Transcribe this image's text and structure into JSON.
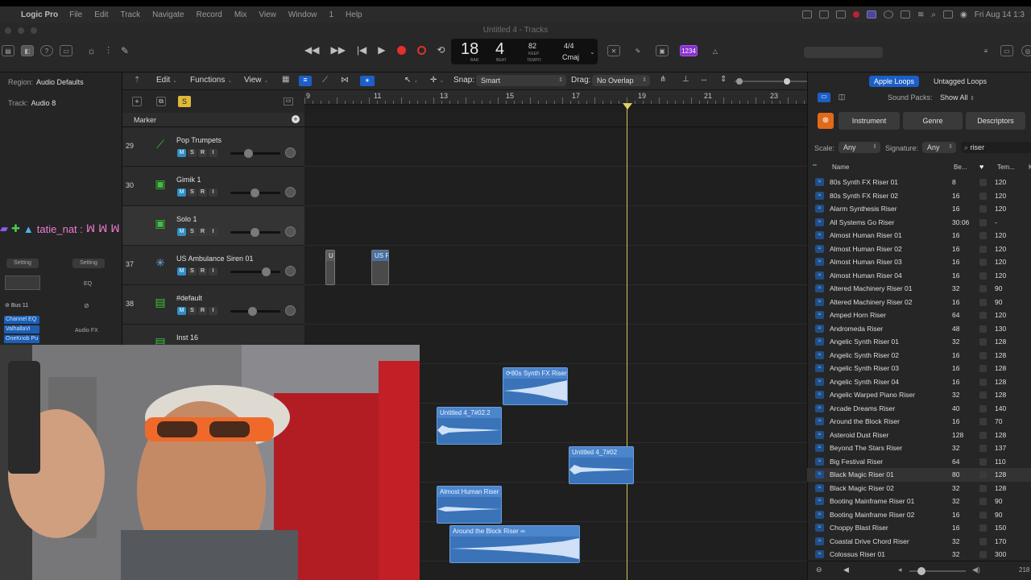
{
  "menubar": {
    "app": "Logic Pro",
    "items": [
      "File",
      "Edit",
      "Track",
      "Navigate",
      "Record",
      "Mix",
      "View",
      "Window",
      "1",
      "Help"
    ],
    "datetime": "Fri Aug 14 1:3"
  },
  "window": {
    "title": "Untitled 4 - Tracks"
  },
  "lcd": {
    "bar": "18",
    "beat": "4",
    "bar_label": "BAR",
    "beat_label": "BEAT",
    "tempo": "82",
    "tempo_mode": "KEEP",
    "tempo_label": "TEMPO",
    "time_signature": "4/4",
    "key": "Cmaj"
  },
  "count_in_badge": "1234",
  "inspector": {
    "region_label": "Region:",
    "region_value": "Audio Defaults",
    "track_label": "Track:",
    "track_value": "Audio 8",
    "setting_left": "Setting",
    "setting_right": "Setting",
    "eq": "EQ",
    "bus": "Bus 11",
    "plugins": [
      "Channel EQ",
      "ValhallaVi",
      "OneKnob Pu"
    ],
    "audio_fx": "Audio FX",
    "chat_user": "tatie_nat :"
  },
  "toolbar": {
    "edit": "Edit",
    "functions": "Functions",
    "view": "View",
    "snap_label": "Snap:",
    "snap_value": "Smart",
    "drag_label": "Drag:",
    "drag_value": "No Overlap"
  },
  "ruler": {
    "bars": [
      "9",
      "11",
      "13",
      "15",
      "17",
      "19",
      "21",
      "23"
    ]
  },
  "marker": {
    "label": "Marker"
  },
  "tracks": [
    {
      "num": "29",
      "name": "Pop Trumpets",
      "color": "#3fbf3f",
      "icon": "trumpet-icon",
      "glyph": "⟋",
      "fader": 0.3
    },
    {
      "num": "30",
      "name": "Gimik 1",
      "color": "#3fbf3f",
      "icon": "synth-icon",
      "glyph": "▣",
      "fader": 0.45
    },
    {
      "num": "",
      "name": "Solo 1",
      "color": "#3fbf3f",
      "icon": "synth-icon",
      "glyph": "▣",
      "fader": 0.45
    },
    {
      "num": "37",
      "name": "US Ambulance Siren 01",
      "color": "#6fa9e8",
      "icon": "star-icon",
      "glyph": "✳",
      "fader": 0.7
    },
    {
      "num": "38",
      "name": "#default",
      "color": "#3fbf3f",
      "icon": "keyboard-icon",
      "glyph": "▤",
      "fader": 0.4
    },
    {
      "num": "",
      "name": "Inst 16",
      "color": "#3fbf3f",
      "icon": "keyboard-icon",
      "glyph": "▤",
      "fader": 0.4
    }
  ],
  "track_buttons": {
    "m": "M",
    "s": "S",
    "r": "R",
    "i": "I"
  },
  "regions": [
    {
      "label": "U"
    },
    {
      "label": "US P"
    },
    {
      "label": "80s Synth FX Riser"
    },
    {
      "label": "Untitled 4_7#02.2"
    },
    {
      "label": "Untitled 4_7#02"
    },
    {
      "label": "Almost Human Riser"
    },
    {
      "label": "Around the Block Riser"
    }
  ],
  "browser": {
    "tab_apple": "Apple Loops",
    "tab_untagged": "Untagged Loops",
    "sound_packs_label": "Sound Packs:",
    "sound_packs_value": "Show All",
    "cat_instrument": "Instrument",
    "cat_genre": "Genre",
    "cat_descriptors": "Descriptors",
    "scale_label": "Scale:",
    "scale_value": "Any",
    "signature_label": "Signature:",
    "signature_value": "Any",
    "search_value": "riser",
    "col_name": "Name",
    "col_beats": "Be...",
    "col_tempo": "Tem...",
    "col_key": "K",
    "footer_count": "218",
    "loops": [
      {
        "name": "80s Synth FX Riser 01",
        "beats": "8",
        "tempo": "120"
      },
      {
        "name": "80s Synth FX Riser 02",
        "beats": "16",
        "tempo": "120"
      },
      {
        "name": "Alarm Synthesis Riser",
        "beats": "16",
        "tempo": "120"
      },
      {
        "name": "All Systems Go Riser",
        "beats": "30:06",
        "tempo": "-"
      },
      {
        "name": "Almost Human Riser 01",
        "beats": "16",
        "tempo": "120"
      },
      {
        "name": "Almost Human Riser 02",
        "beats": "16",
        "tempo": "120"
      },
      {
        "name": "Almost Human Riser 03",
        "beats": "16",
        "tempo": "120"
      },
      {
        "name": "Almost Human Riser 04",
        "beats": "16",
        "tempo": "120"
      },
      {
        "name": "Altered Machinery Riser 01",
        "beats": "32",
        "tempo": "90"
      },
      {
        "name": "Altered Machinery Riser 02",
        "beats": "16",
        "tempo": "90"
      },
      {
        "name": "Amped Horn Riser",
        "beats": "64",
        "tempo": "120"
      },
      {
        "name": "Andromeda Riser",
        "beats": "48",
        "tempo": "130"
      },
      {
        "name": "Angelic Synth Riser 01",
        "beats": "32",
        "tempo": "128"
      },
      {
        "name": "Angelic Synth Riser 02",
        "beats": "16",
        "tempo": "128"
      },
      {
        "name": "Angelic Synth Riser 03",
        "beats": "16",
        "tempo": "128"
      },
      {
        "name": "Angelic Synth Riser 04",
        "beats": "16",
        "tempo": "128"
      },
      {
        "name": "Angelic Warped Piano Riser",
        "beats": "32",
        "tempo": "128"
      },
      {
        "name": "Arcade Dreams Riser",
        "beats": "40",
        "tempo": "140"
      },
      {
        "name": "Around the Block Riser",
        "beats": "16",
        "tempo": "70"
      },
      {
        "name": "Asteroid Dust Riser",
        "beats": "128",
        "tempo": "128"
      },
      {
        "name": "Beyond The Stars Riser",
        "beats": "32",
        "tempo": "137"
      },
      {
        "name": "Big Festival Riser",
        "beats": "64",
        "tempo": "110"
      },
      {
        "name": "Black Magic Riser 01",
        "beats": "80",
        "tempo": "128"
      },
      {
        "name": "Black Magic Riser 02",
        "beats": "32",
        "tempo": "128"
      },
      {
        "name": "Booting Mainframe Riser 01",
        "beats": "32",
        "tempo": "90"
      },
      {
        "name": "Booting Mainframe Riser 02",
        "beats": "16",
        "tempo": "90"
      },
      {
        "name": "Choppy Blast Riser",
        "beats": "16",
        "tempo": "150"
      },
      {
        "name": "Coastal Drive Chord Riser",
        "beats": "32",
        "tempo": "170"
      },
      {
        "name": "Colossus Riser 01",
        "beats": "32",
        "tempo": "300"
      }
    ]
  }
}
